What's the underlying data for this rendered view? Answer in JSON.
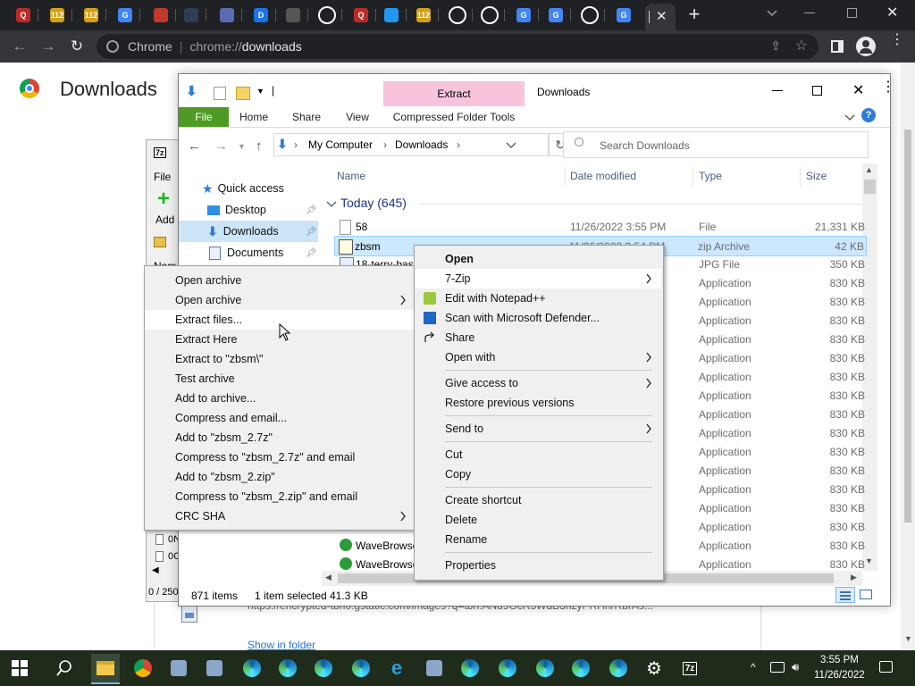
{
  "browser": {
    "name": "Chrome",
    "url_prefix": "chrome://",
    "url_path": "downloads",
    "tabs": [
      {
        "icon": "quora-icon",
        "color": "#b92b27",
        "label": "Q"
      },
      {
        "icon": "112-icon",
        "color": "#d4a017",
        "label": "112"
      },
      {
        "icon": "112-icon",
        "color": "#d4a017",
        "label": "112"
      },
      {
        "icon": "google-icon",
        "color": "#4285f4",
        "label": "G"
      },
      {
        "icon": "brush-icon",
        "color": "#c0392b",
        "label": ""
      },
      {
        "icon": "dark-icon",
        "color": "#2c3e50",
        "label": ""
      },
      {
        "icon": "mail-icon",
        "color": "#5b6bb3",
        "label": ""
      },
      {
        "icon": "d-app-icon",
        "color": "#1a73e8",
        "label": "D"
      },
      {
        "icon": "check-icon",
        "color": "#555555",
        "label": ""
      },
      {
        "icon": "shield-icon",
        "color": "#ffffff",
        "label": ""
      },
      {
        "icon": "quora-icon",
        "color": "#b92b27",
        "label": "Q"
      },
      {
        "icon": "chart-icon",
        "color": "#2196f3",
        "label": ""
      },
      {
        "icon": "112-icon",
        "color": "#d4a017",
        "label": "112"
      },
      {
        "icon": "github-icon",
        "color": "#ffffff",
        "label": ""
      },
      {
        "icon": "github-icon",
        "color": "#ffffff",
        "label": ""
      },
      {
        "icon": "google-icon",
        "color": "#4285f4",
        "label": "G"
      },
      {
        "icon": "google-icon",
        "color": "#4285f4",
        "label": "G"
      },
      {
        "icon": "github-icon",
        "color": "#ffffff",
        "label": ""
      },
      {
        "icon": "google-icon",
        "color": "#4285f4",
        "label": "G"
      }
    ]
  },
  "downloads_page": {
    "title": "Downloads",
    "partial_url": "https://encrypted-tbn0.gstatic.com/images?q=tbn:ANd9GcR5WdB3hzyPRHhrRbrAs...",
    "show_in_folder": "Show in folder"
  },
  "sevenzip": {
    "title_icon": "7z",
    "menu_file": "File",
    "add_label": "Add",
    "col_name": "Nam",
    "rows": [
      "0N",
      "0C"
    ],
    "status": "0 / 250"
  },
  "explorer": {
    "qat_label": "|",
    "tab_context": "Extract",
    "window_title": "Downloads",
    "ribbon_tabs": [
      "File",
      "Home",
      "Share",
      "View",
      "Compressed Folder Tools"
    ],
    "breadcrumb": [
      "My Computer",
      "Downloads"
    ],
    "search_placeholder": "Search Downloads",
    "columns": {
      "name": "Name",
      "date": "Date modified",
      "type": "Type",
      "size": "Size"
    },
    "group": "Today (645)",
    "nav": [
      {
        "label": "Quick access",
        "icon": "star-icon"
      },
      {
        "label": "Desktop",
        "icon": "desktop-icon"
      },
      {
        "label": "Downloads",
        "icon": "download-arrow-icon"
      },
      {
        "label": "Documents",
        "icon": "document-icon"
      }
    ],
    "files": [
      {
        "name": "58",
        "date": "11/26/2022 3:55 PM",
        "type": "File",
        "size": "21,331 KB",
        "icon": "file-icon"
      },
      {
        "name": "zbsm",
        "date": "11/26/2022 3:54 PM",
        "type": "zip Archive",
        "size": "42 KB",
        "icon": "zip-icon"
      },
      {
        "name": "18-terry-bast",
        "date": "",
        "type": "JPG File",
        "size": "350 KB",
        "icon": "image-icon"
      },
      {
        "name": "",
        "date": "",
        "type": "Application",
        "size": "830 KB",
        "icon": ""
      },
      {
        "name": "",
        "date": "",
        "type": "Application",
        "size": "830 KB",
        "icon": ""
      },
      {
        "name": "",
        "date": "",
        "type": "Application",
        "size": "830 KB",
        "icon": ""
      },
      {
        "name": "",
        "date": "",
        "type": "Application",
        "size": "830 KB",
        "icon": ""
      },
      {
        "name": "",
        "date": "",
        "type": "Application",
        "size": "830 KB",
        "icon": ""
      },
      {
        "name": "",
        "date": "",
        "type": "Application",
        "size": "830 KB",
        "icon": ""
      },
      {
        "name": "",
        "date": "",
        "type": "Application",
        "size": "830 KB",
        "icon": ""
      },
      {
        "name": "",
        "date": "",
        "type": "Application",
        "size": "830 KB",
        "icon": ""
      },
      {
        "name": "",
        "date": "",
        "type": "Application",
        "size": "830 KB",
        "icon": ""
      },
      {
        "name": "",
        "date": "",
        "type": "Application",
        "size": "830 KB",
        "icon": ""
      },
      {
        "name": "",
        "date": "",
        "type": "Application",
        "size": "830 KB",
        "icon": ""
      },
      {
        "name": "",
        "date": "",
        "type": "Application",
        "size": "830 KB",
        "icon": ""
      },
      {
        "name": "",
        "date": "",
        "type": "Application",
        "size": "830 KB",
        "icon": ""
      },
      {
        "name": "",
        "date": "",
        "type": "Application",
        "size": "830 KB",
        "icon": ""
      },
      {
        "name": "WaveBrowse",
        "date": "",
        "type": "Application",
        "size": "830 KB",
        "icon": "wave-icon"
      },
      {
        "name": "WaveBrowse",
        "date": "",
        "type": "Application",
        "size": "830 KB",
        "icon": "wave-icon"
      }
    ],
    "status_items": "871 items",
    "status_selected": "1 item selected",
    "status_size": "41.3 KB"
  },
  "zip_menu": [
    {
      "label": "Open archive",
      "sub": false
    },
    {
      "label": "Open archive",
      "sub": true
    },
    {
      "label": "Extract files...",
      "sub": false,
      "hover": true
    },
    {
      "label": "Extract Here",
      "sub": false
    },
    {
      "label": "Extract to \"zbsm\\\"",
      "sub": false
    },
    {
      "label": "Test archive",
      "sub": false
    },
    {
      "label": "Add to archive...",
      "sub": false
    },
    {
      "label": "Compress and email...",
      "sub": false
    },
    {
      "label": "Add to \"zbsm_2.7z\"",
      "sub": false
    },
    {
      "label": "Compress to \"zbsm_2.7z\" and email",
      "sub": false
    },
    {
      "label": "Add to \"zbsm_2.zip\"",
      "sub": false
    },
    {
      "label": "Compress to \"zbsm_2.zip\" and email",
      "sub": false
    },
    {
      "label": "CRC SHA",
      "sub": true
    }
  ],
  "context_menu": [
    {
      "label": "Open",
      "bold": true,
      "sub": false,
      "icon": ""
    },
    {
      "label": "7-Zip",
      "sub": true,
      "icon": "",
      "hover": true
    },
    {
      "label": "Edit with Notepad++",
      "sub": false,
      "icon": "notepad-icon"
    },
    {
      "label": "Scan with Microsoft Defender...",
      "sub": false,
      "icon": "defender-icon"
    },
    {
      "label": "Share",
      "sub": false,
      "icon": "share-icon"
    },
    {
      "label": "Open with",
      "sub": true,
      "icon": ""
    },
    {
      "sep": true
    },
    {
      "label": "Give access to",
      "sub": true,
      "icon": ""
    },
    {
      "label": "Restore previous versions",
      "sub": false,
      "icon": ""
    },
    {
      "sep": true
    },
    {
      "label": "Send to",
      "sub": true,
      "icon": ""
    },
    {
      "sep": true
    },
    {
      "label": "Cut",
      "sub": false,
      "icon": ""
    },
    {
      "label": "Copy",
      "sub": false,
      "icon": ""
    },
    {
      "sep": true
    },
    {
      "label": "Create shortcut",
      "sub": false,
      "icon": ""
    },
    {
      "label": "Delete",
      "sub": false,
      "icon": ""
    },
    {
      "label": "Rename",
      "sub": false,
      "icon": ""
    },
    {
      "sep": true
    },
    {
      "label": "Properties",
      "sub": false,
      "icon": ""
    }
  ],
  "taskbar": {
    "time": "3:55 PM",
    "date": "11/26/2022",
    "apps": [
      "file-explorer-icon",
      "chrome-icon",
      "paint-icon",
      "tool-icon",
      "edge-icon",
      "edge-icon",
      "edge-icon",
      "edge-icon",
      "ie-icon",
      "app-icon",
      "edge-icon",
      "edge-icon",
      "edge-icon",
      "edge-icon",
      "edge-icon",
      "gear-icon",
      "7zip-icon"
    ]
  }
}
